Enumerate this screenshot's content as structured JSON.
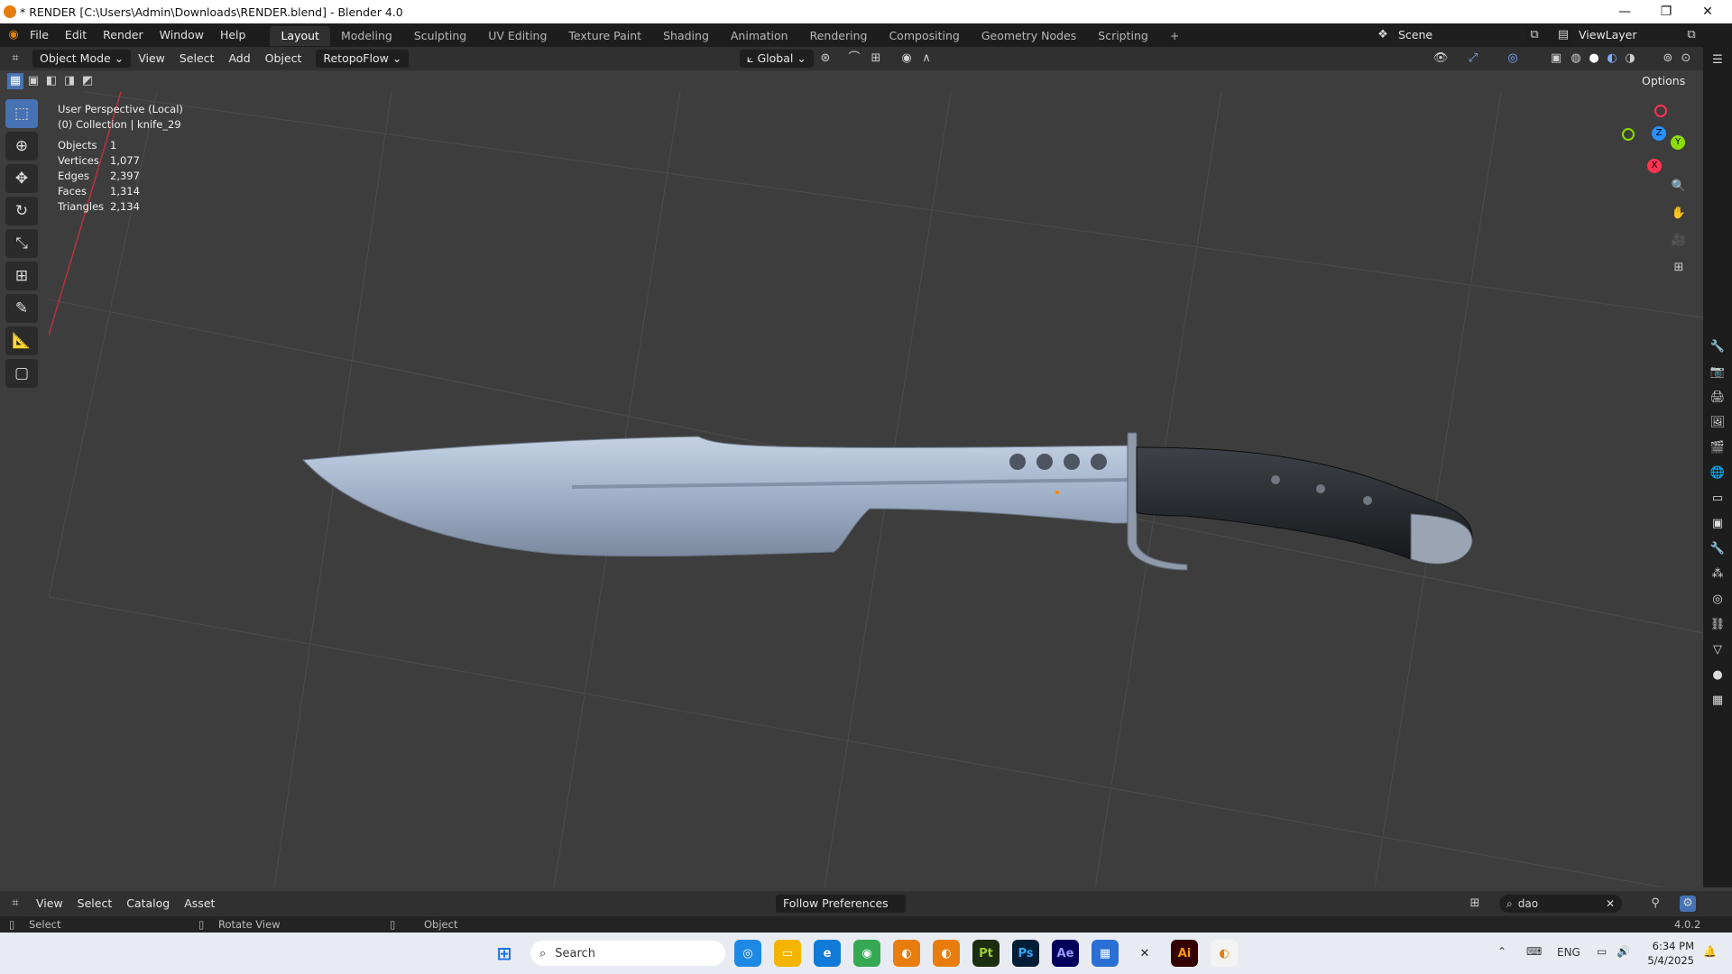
{
  "window": {
    "title": "* RENDER [C:\\Users\\Admin\\Downloads\\RENDER.blend] - Blender 4.0",
    "minimize": "—",
    "maximize": "❐",
    "close": "✕"
  },
  "menu": [
    "File",
    "Edit",
    "Render",
    "Window",
    "Help"
  ],
  "workspaces": [
    "Layout",
    "Modeling",
    "Sculpting",
    "UV Editing",
    "Texture Paint",
    "Shading",
    "Animation",
    "Rendering",
    "Compositing",
    "Geometry Nodes",
    "Scripting"
  ],
  "active_workspace": "Layout",
  "add_workspace": "+",
  "scene": {
    "label": "Scene",
    "view_layer": "ViewLayer"
  },
  "header": {
    "mode": "Object Mode",
    "view": "View",
    "select": "Select",
    "add": "Add",
    "object": "Object",
    "addon": "RetopoFlow",
    "orientation": "Global",
    "options": "Options"
  },
  "viewport": {
    "perspective": "User Perspective (Local)",
    "collection": "(0) Collection | knife_29",
    "stats": [
      {
        "key": "Objects",
        "value": "1"
      },
      {
        "key": "Vertices",
        "value": "1,077"
      },
      {
        "key": "Edges",
        "value": "2,397"
      },
      {
        "key": "Faces",
        "value": "1,314"
      },
      {
        "key": "Triangles",
        "value": "2,134"
      }
    ],
    "gizmo": {
      "x": "X",
      "y": "Y",
      "z": "Z"
    }
  },
  "asset_bar": {
    "view": "View",
    "select": "Select",
    "catalog": "Catalog",
    "asset": "Asset",
    "import": "Follow Preferences",
    "search_value": "dao"
  },
  "status": {
    "left": "Select",
    "middle": "Rotate View",
    "right": "Object",
    "version": "4.0.2"
  },
  "taskbar": {
    "search": "Search",
    "lang": "ENG",
    "time": "6:34 PM",
    "date": "5/4/2025",
    "apps": [
      "Pt",
      "Ps",
      "Ae",
      "Ai"
    ]
  },
  "colors": {
    "accent": "#4772b3",
    "x_axis": "#ff3352",
    "y_axis": "#8bdc00",
    "z_axis": "#2890ff"
  }
}
